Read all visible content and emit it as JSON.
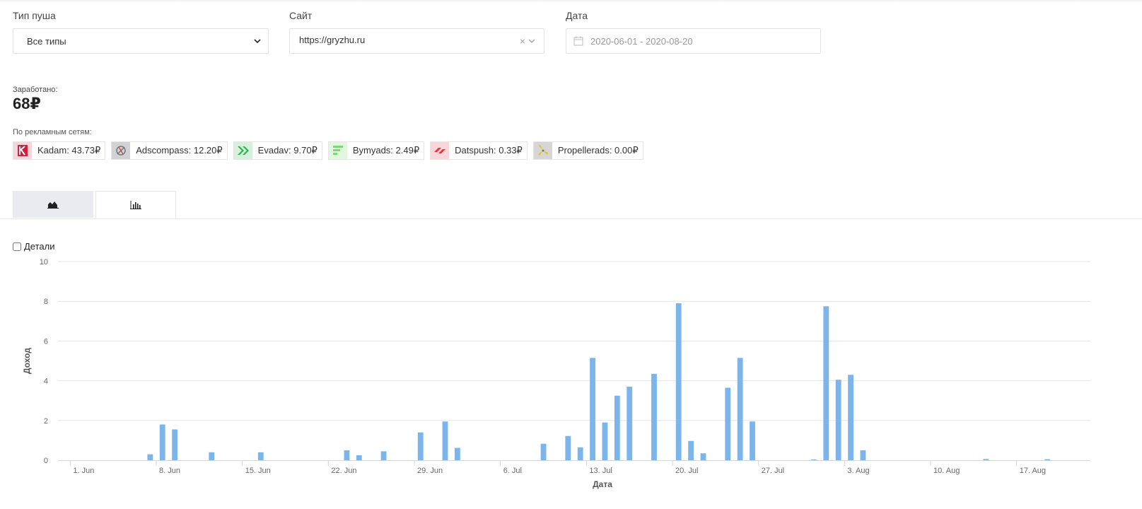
{
  "filters": {
    "push_type": {
      "label": "Тип пуша",
      "value": "Все типы"
    },
    "site": {
      "label": "Сайт",
      "value": "https://gryzhu.ru",
      "clear": "×"
    },
    "date": {
      "label": "Дата",
      "value": "2020-06-01 - 2020-08-20"
    }
  },
  "earned": {
    "label": "Заработано:",
    "value": "68₽"
  },
  "networks": {
    "label": "По рекламным сетям:",
    "items": [
      {
        "name": "Kadam: 43.73₽",
        "color": "#d21f3c",
        "bg": "#f6d6db"
      },
      {
        "name": "Adscompass: 12.20₽",
        "color": "#777777",
        "bg": "#d0d2d6"
      },
      {
        "name": "Evadav: 9.70₽",
        "color": "#2bb24c",
        "bg": "#d5f1dc"
      },
      {
        "name": "Bymyads: 2.49₽",
        "color": "#7fd77a",
        "bg": "#e2f7df"
      },
      {
        "name": "Datspush: 0.33₽",
        "color": "#e8333b",
        "bg": "#fbd6d8"
      },
      {
        "name": "Propellerads: 0.00₽",
        "color": "#e6c21c",
        "bg": "#d6d6d6"
      }
    ]
  },
  "tabs": [
    {
      "icon": "area-chart-icon",
      "active": false
    },
    {
      "icon": "bar-chart-icon",
      "active": true
    }
  ],
  "details": {
    "label": "Детали",
    "checked": false
  },
  "chart_data": {
    "type": "bar",
    "xlabel": "Дата",
    "ylabel": "Доход",
    "ylim": [
      0,
      10
    ],
    "yticks": [
      0,
      2,
      4,
      6,
      8,
      10
    ],
    "xlim": [
      "2020-05-31",
      "2020-08-23"
    ],
    "xticks": [
      {
        "date": "2020-06-01",
        "label": "1. Jun"
      },
      {
        "date": "2020-06-08",
        "label": "8. Jun"
      },
      {
        "date": "2020-06-15",
        "label": "15. Jun"
      },
      {
        "date": "2020-06-22",
        "label": "22. Jun"
      },
      {
        "date": "2020-06-29",
        "label": "29. Jun"
      },
      {
        "date": "2020-07-06",
        "label": "6. Jul"
      },
      {
        "date": "2020-07-13",
        "label": "13. Jul"
      },
      {
        "date": "2020-07-20",
        "label": "20. Jul"
      },
      {
        "date": "2020-07-27",
        "label": "27. Jul"
      },
      {
        "date": "2020-08-03",
        "label": "3. Aug"
      },
      {
        "date": "2020-08-10",
        "label": "10. Aug"
      },
      {
        "date": "2020-08-17",
        "label": "17. Aug"
      }
    ],
    "grid": true,
    "color": "#7cb5ec",
    "x": [
      "2020-06-07",
      "2020-06-08",
      "2020-06-09",
      "2020-06-12",
      "2020-06-16",
      "2020-06-23",
      "2020-06-24",
      "2020-06-26",
      "2020-06-29",
      "2020-07-01",
      "2020-07-02",
      "2020-07-09",
      "2020-07-11",
      "2020-07-12",
      "2020-07-13",
      "2020-07-14",
      "2020-07-15",
      "2020-07-16",
      "2020-07-18",
      "2020-07-20",
      "2020-07-21",
      "2020-07-22",
      "2020-07-24",
      "2020-07-25",
      "2020-07-26",
      "2020-07-31",
      "2020-08-01",
      "2020-08-02",
      "2020-08-03",
      "2020-08-04",
      "2020-08-14",
      "2020-08-19"
    ],
    "values": [
      0.3,
      1.8,
      1.55,
      0.4,
      0.4,
      0.5,
      0.25,
      0.45,
      1.4,
      1.95,
      0.62,
      0.83,
      1.22,
      0.65,
      5.15,
      1.9,
      3.25,
      3.7,
      4.35,
      7.9,
      0.97,
      0.35,
      3.65,
      5.15,
      1.95,
      0.04,
      7.75,
      4.05,
      4.3,
      0.5,
      0.06,
      0.05
    ]
  }
}
